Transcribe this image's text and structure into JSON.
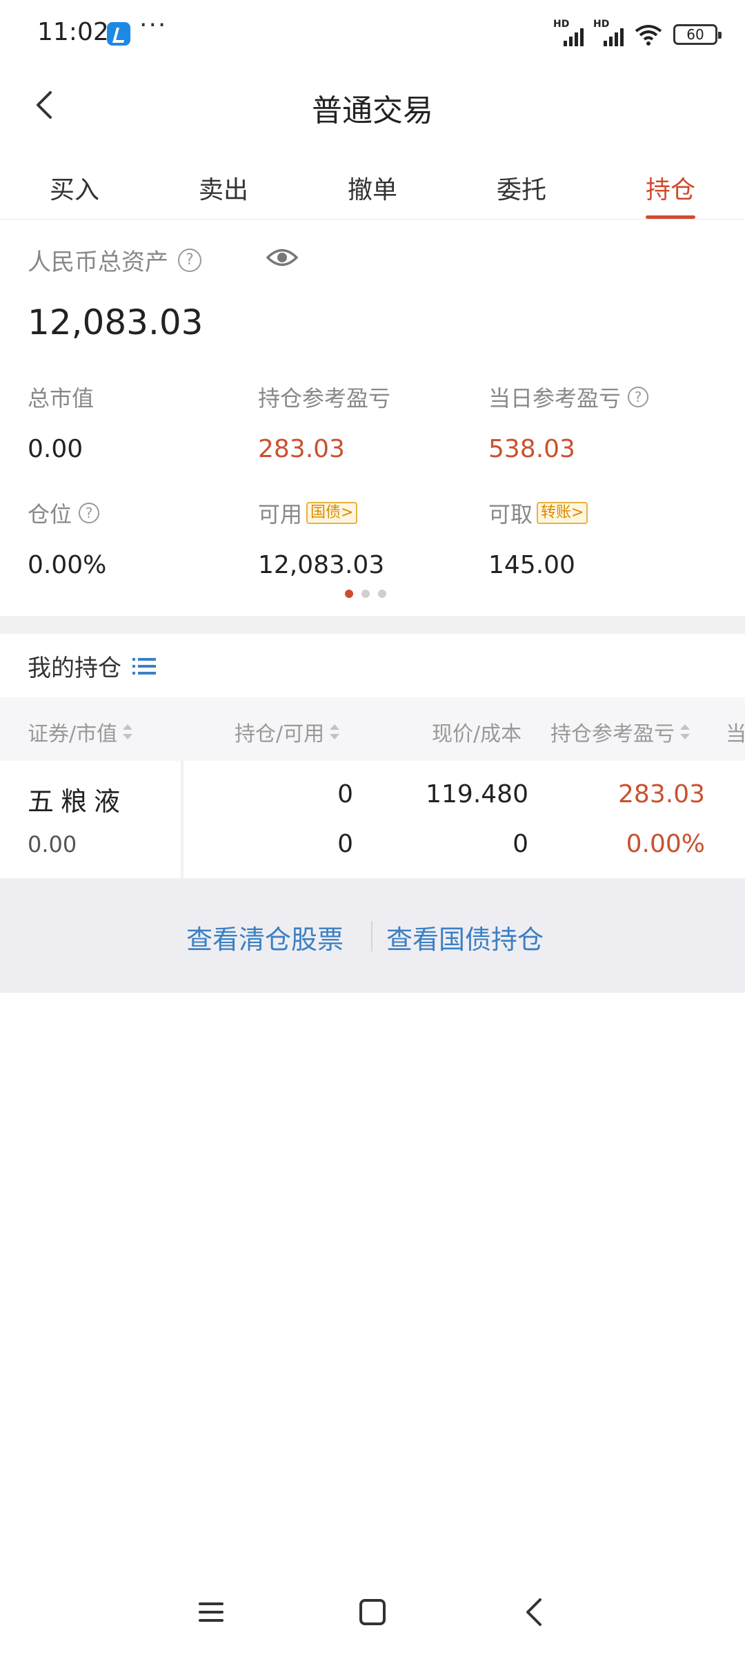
{
  "status_bar": {
    "time": "11:02",
    "more": "···",
    "signal_label": "HD",
    "battery": "60"
  },
  "header": {
    "title": "普通交易"
  },
  "tabs": [
    {
      "label": "买入",
      "active": false
    },
    {
      "label": "卖出",
      "active": false
    },
    {
      "label": "撤单",
      "active": false
    },
    {
      "label": "委托",
      "active": false
    },
    {
      "label": "持仓",
      "active": true
    }
  ],
  "assets": {
    "label": "人民币总资产",
    "total": "12,083.03",
    "metrics": [
      {
        "label": "总市值",
        "value": "0.00"
      },
      {
        "label": "持仓参考盈亏",
        "value": "283.03"
      },
      {
        "label": "当日参考盈亏",
        "value": "538.03"
      },
      {
        "label": "仓位",
        "value": "0.00%"
      },
      {
        "label": "可用",
        "tag": "国债>",
        "value": "12,083.03"
      },
      {
        "label": "可取",
        "tag": "转账>",
        "value": "145.00"
      }
    ]
  },
  "holdings": {
    "title": "我的持仓",
    "columns": [
      "证券/市值",
      "持仓/可用",
      "现价/成本",
      "持仓参考盈亏",
      "当"
    ],
    "rows": [
      {
        "name": "五粮液",
        "market_value": "0.00",
        "position": "0",
        "available": "0",
        "price": "119.480",
        "cost": "0",
        "pnl": "283.03",
        "pnl_pct": "0.00%"
      }
    ]
  },
  "footer": {
    "link_cleared": "查看清仓股票",
    "link_bonds": "查看国债持仓"
  },
  "colors": {
    "accent": "#cf4b2e",
    "profit": "#c9512f",
    "link": "#3b7fc4",
    "tag": "#d98a00"
  }
}
